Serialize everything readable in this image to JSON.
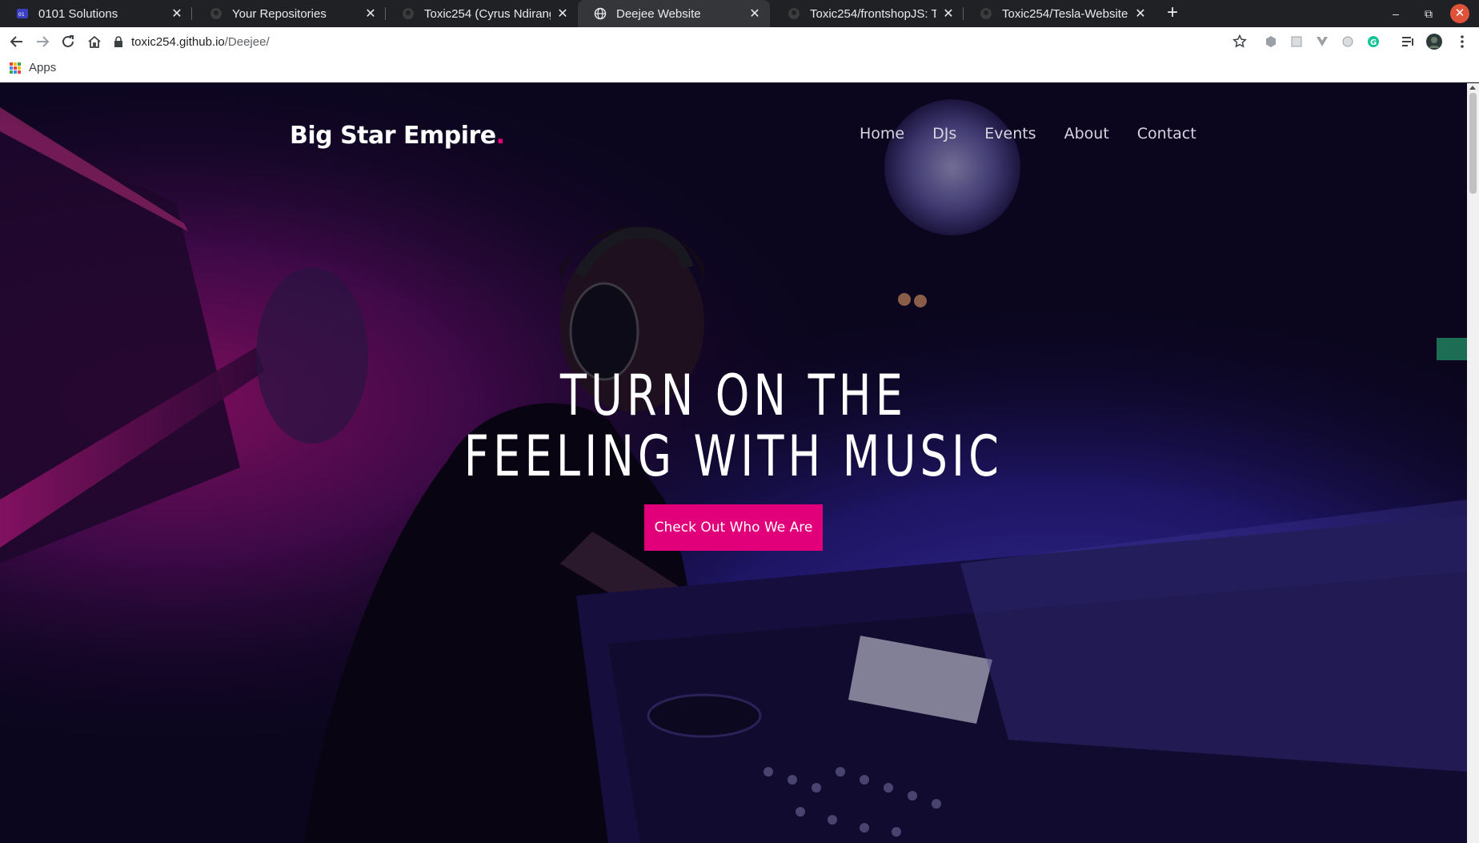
{
  "browser": {
    "tabs": [
      {
        "title": "0101 Solutions",
        "icon": "site-favicon-icon"
      },
      {
        "title": "Your Repositories",
        "icon": "github-icon"
      },
      {
        "title": "Toxic254 (Cyrus Ndirangu",
        "icon": "github-icon"
      },
      {
        "title": "Deejee Website",
        "icon": "globe-icon",
        "active": true
      },
      {
        "title": "Toxic254/frontshopJS: Th",
        "icon": "github-icon"
      },
      {
        "title": "Toxic254/Tesla-Website",
        "icon": "github-icon"
      }
    ],
    "url_host": "toxic254.github.io",
    "url_path": "/Deejee/",
    "bookmarks": {
      "apps_label": "Apps"
    }
  },
  "site": {
    "brand": "Big Star Empire",
    "brand_dot": ".",
    "nav": [
      "Home",
      "DJs",
      "Events",
      "About",
      "Contact"
    ],
    "hero_line1": "TURN ON THE",
    "hero_line2": "FEELING WITH MUSIC",
    "cta_label": "Check Out Who We Are"
  },
  "colors": {
    "accent": "#e2007a",
    "overlay": "#0d0820"
  }
}
